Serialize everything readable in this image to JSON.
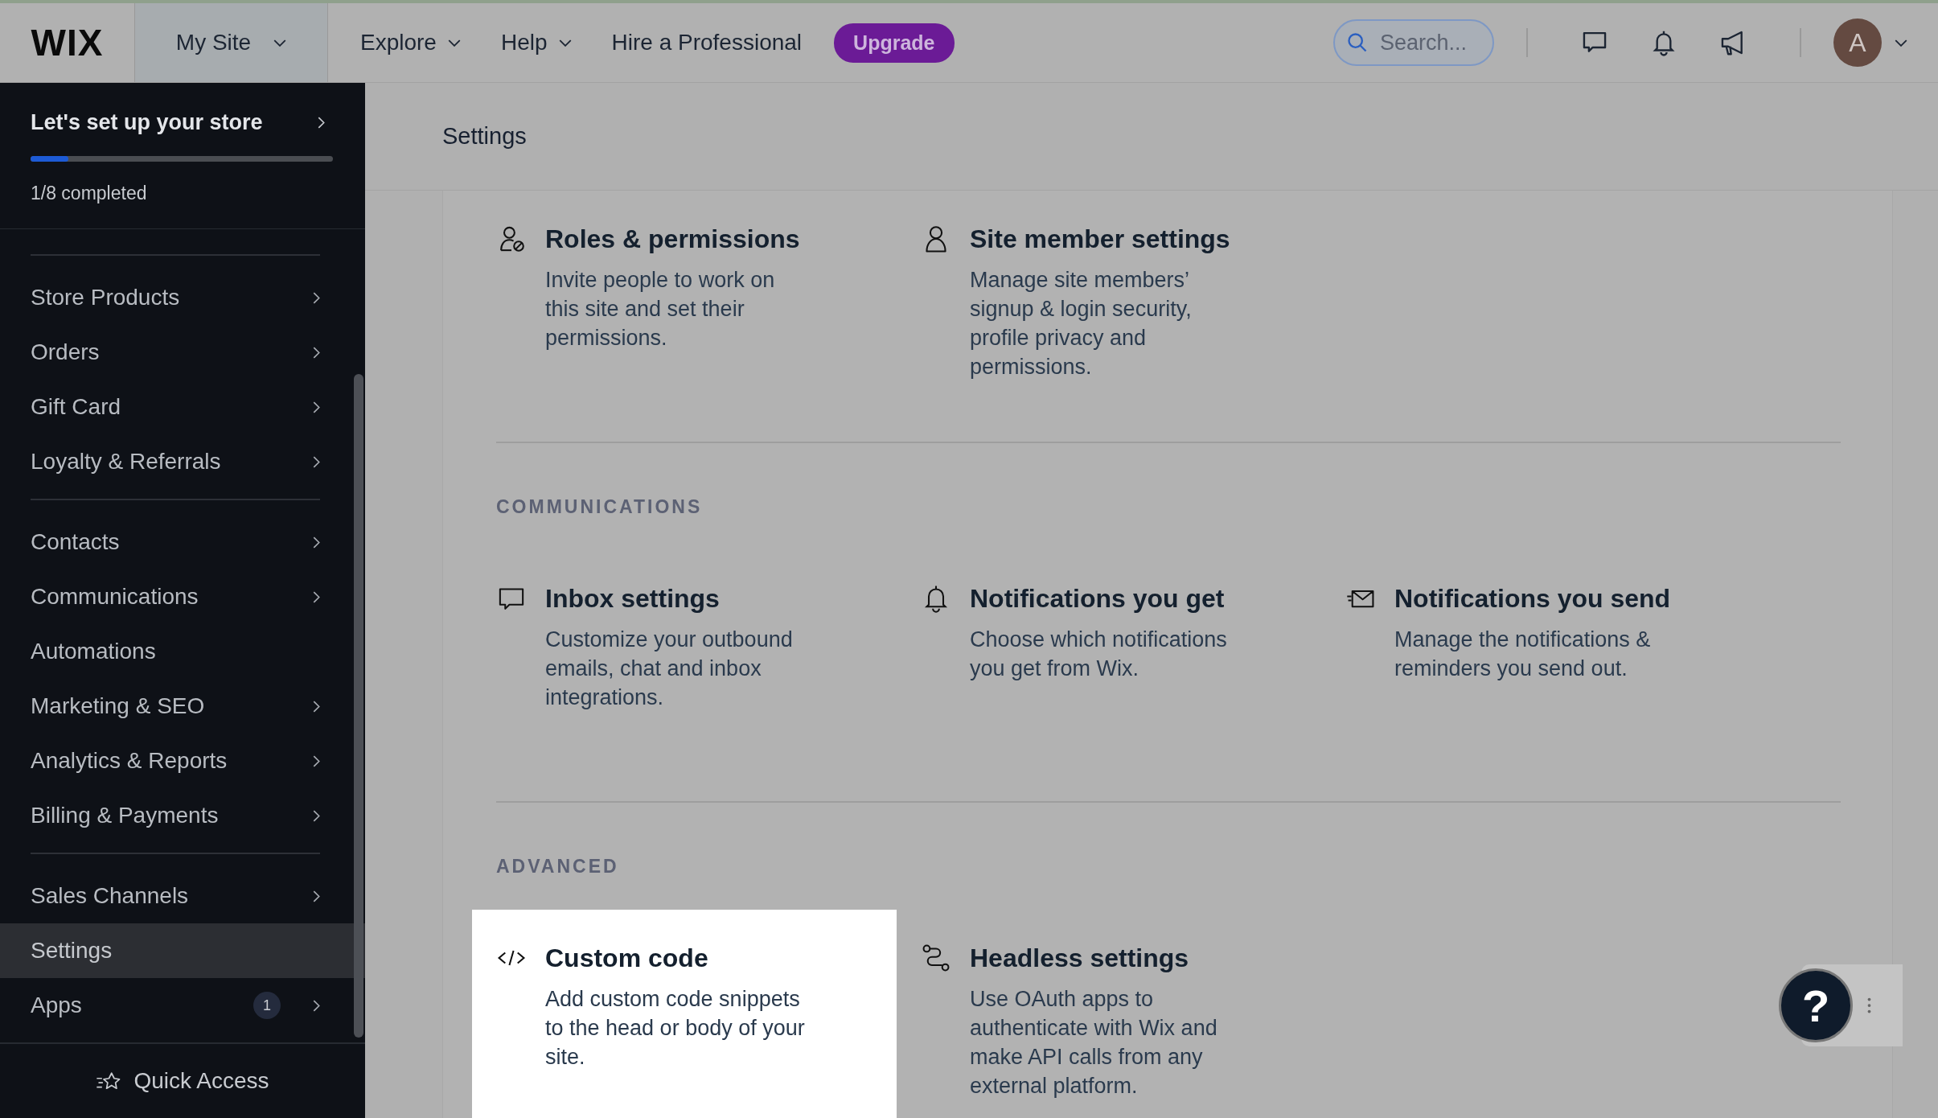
{
  "topbar": {
    "logo": "WIX",
    "site_menu": "My Site",
    "nav": [
      {
        "label": "Explore",
        "dropdown": true
      },
      {
        "label": "Help",
        "dropdown": true
      },
      {
        "label": "Hire a Professional",
        "dropdown": false
      }
    ],
    "upgrade": "Upgrade",
    "search": {
      "placeholder": "Search..."
    },
    "avatar": "A"
  },
  "sidebar": {
    "setup": {
      "title": "Let's set up your store",
      "level": 0.125,
      "progress": "1/8 completed"
    },
    "groups": [
      [
        {
          "label": "Store Products",
          "selected": false,
          "arrow": true
        },
        {
          "label": "Orders",
          "selected": false,
          "arrow": true
        },
        {
          "label": "Gift Card",
          "selected": false,
          "arrow": true
        },
        {
          "label": "Loyalty & Referrals",
          "selected": false,
          "arrow": true
        }
      ],
      [
        {
          "label": "Contacts",
          "selected": false,
          "arrow": true
        },
        {
          "label": "Communications",
          "selected": false,
          "arrow": true
        },
        {
          "label": "Automations",
          "selected": false,
          "arrow": false
        },
        {
          "label": "Marketing & SEO",
          "selected": false,
          "arrow": true
        },
        {
          "label": "Analytics & Reports",
          "selected": false,
          "arrow": true
        },
        {
          "label": "Billing & Payments",
          "selected": false,
          "arrow": true
        }
      ],
      [
        {
          "label": "Sales Channels",
          "selected": false,
          "arrow": true
        },
        {
          "label": "Settings",
          "selected": true,
          "arrow": false
        },
        {
          "label": "Apps",
          "selected": false,
          "arrow": true,
          "badge": "1"
        }
      ]
    ],
    "quick_access": "Quick Access"
  },
  "page_title": "Settings",
  "sections": [
    {
      "items": [
        {
          "kind": "roles",
          "title": "Roles & permissions",
          "description": "Invite people to work on this site and set their permissions.",
          "highlighted": false
        },
        {
          "kind": "member",
          "title": "Site member settings",
          "description": "Manage site members’ signup & login security, profile privacy and permissions.",
          "highlighted": false
        }
      ]
    },
    {
      "heading": "COMMUNICATIONS",
      "items": [
        {
          "kind": "chat",
          "title": "Inbox settings",
          "description": "Customize your outbound emails, chat and inbox integrations.",
          "highlighted": false
        },
        {
          "kind": "bell",
          "title": "Notifications you get",
          "description": "Choose which notifications you get from Wix.",
          "highlighted": false
        },
        {
          "kind": "envelope",
          "title": "Notifications you send",
          "description": "Manage the notifications & reminders you send out.",
          "highlighted": false
        }
      ]
    },
    {
      "heading": "ADVANCED",
      "items": [
        {
          "kind": "code",
          "title": "Custom code",
          "description": "Add custom code snippets to the head or body of your site.",
          "highlighted": true
        },
        {
          "kind": "nodes",
          "title": "Headless settings",
          "description": "Use OAuth apps to authenticate with Wix and make API calls from any external platform.",
          "highlighted": false
        }
      ]
    }
  ],
  "help_button": "?"
}
